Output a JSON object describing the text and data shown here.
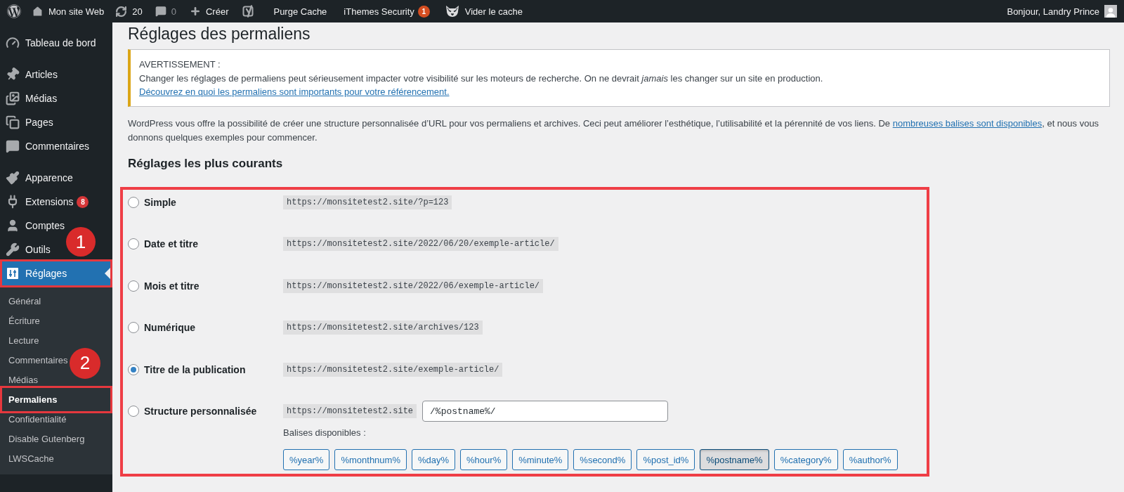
{
  "admin_bar": {
    "items": [
      {
        "kind": "logo"
      },
      {
        "kind": "site",
        "label": "Mon site Web"
      },
      {
        "kind": "updates",
        "label": "20"
      },
      {
        "kind": "comments",
        "label": "0"
      },
      {
        "kind": "new",
        "label": "Créer"
      },
      {
        "kind": "seo"
      },
      {
        "kind": "text",
        "label": "Purge Cache"
      },
      {
        "kind": "text",
        "label": "iThemes Security",
        "badge": "1"
      },
      {
        "kind": "cache",
        "label": "Vider le cache"
      }
    ],
    "account": {
      "greeting": "Bonjour, Landry Prince"
    }
  },
  "sidebar": {
    "groups": [
      {
        "items": [
          {
            "label": "Tableau de bord",
            "selected": false,
            "highlighted": false
          }
        ]
      },
      {
        "items": [
          {
            "label": "Articles",
            "selected": false,
            "highlighted": false
          },
          {
            "label": "Médias",
            "selected": false,
            "highlighted": false
          },
          {
            "label": "Pages",
            "selected": false,
            "highlighted": false
          },
          {
            "label": "Commentaires",
            "selected": false,
            "highlighted": false
          }
        ]
      },
      {
        "items": [
          {
            "label": "Apparence",
            "selected": false,
            "highlighted": false
          },
          {
            "label": "Extensions",
            "selected": false,
            "highlighted": false,
            "badge": "8"
          },
          {
            "label": "Comptes",
            "selected": false,
            "highlighted": false
          },
          {
            "label": "Outils",
            "selected": false,
            "highlighted": false
          },
          {
            "label": "Réglages",
            "selected": true,
            "highlighted": true,
            "callout": "1",
            "children": [
              {
                "label": "Général",
                "selected": false,
                "highlighted": false
              },
              {
                "label": "Écriture",
                "selected": false,
                "highlighted": false
              },
              {
                "label": "Lecture",
                "selected": false,
                "highlighted": false
              },
              {
                "label": "Commentaires",
                "selected": false,
                "highlighted": false
              },
              {
                "label": "Médias",
                "selected": false,
                "highlighted": false
              },
              {
                "label": "Permaliens",
                "selected": true,
                "highlighted": true,
                "callout": "2"
              },
              {
                "label": "Confidentialité",
                "selected": false,
                "highlighted": false
              },
              {
                "label": "Disable Gutenberg",
                "selected": false,
                "highlighted": false
              },
              {
                "label": "LWSCache",
                "selected": false,
                "highlighted": false
              }
            ]
          }
        ]
      }
    ]
  },
  "page": {
    "title": "Réglages des permaliens"
  },
  "notice": {
    "title": "AVERTISSEMENT :",
    "message": "Changer les réglages de permaliens peut sérieusement impacter votre visibilité sur les moteurs de recherche. On ne devrait *jamais* les changer sur un site en production.",
    "link": "Découvrez en quoi les permaliens sont importants pour votre référencement."
  },
  "intro": {
    "before": "WordPress vous offre la possibilité de créer une structure personnalisée d’URL pour vos permaliens et archives. Ceci peut améliorer l’esthétique, l’utilisabilité et la pérennité de vos liens. De ",
    "link": "nombreuses balises sont disponibles",
    "after": ", et nous vous donnons quelques exemples pour commencer."
  },
  "common_settings": {
    "heading": "Réglages les plus courants",
    "highlighted": true,
    "options": [
      {
        "kind": "preset",
        "label": "Simple",
        "example": "https://monsitetest2.site/?p=123",
        "selected": false
      },
      {
        "kind": "preset",
        "label": "Date et titre",
        "example": "https://monsitetest2.site/2022/06/20/exemple-article/",
        "selected": false
      },
      {
        "kind": "preset",
        "label": "Mois et titre",
        "example": "https://monsitetest2.site/2022/06/exemple-article/",
        "selected": false
      },
      {
        "kind": "preset",
        "label": "Numérique",
        "example": "https://monsitetest2.site/archives/123",
        "selected": false
      },
      {
        "kind": "preset",
        "label": "Titre de la publication",
        "example": "https://monsitetest2.site/exemple-article/",
        "selected": true
      },
      {
        "kind": "custom",
        "label": "Structure personnalisée",
        "example": "https://monsitetest2.site",
        "selected": false,
        "value": "/%postname%/",
        "tags_label": "Balises disponibles :",
        "tags": [
          {
            "label": "%year%",
            "selected": false
          },
          {
            "label": "%monthnum%",
            "selected": false
          },
          {
            "label": "%day%",
            "selected": false
          },
          {
            "label": "%hour%",
            "selected": false
          },
          {
            "label": "%minute%",
            "selected": false
          },
          {
            "label": "%second%",
            "selected": false
          },
          {
            "label": "%post_id%",
            "selected": false
          },
          {
            "label": "%postname%",
            "selected": true
          },
          {
            "label": "%category%",
            "selected": false
          },
          {
            "label": "%author%",
            "selected": false
          }
        ]
      }
    ]
  }
}
